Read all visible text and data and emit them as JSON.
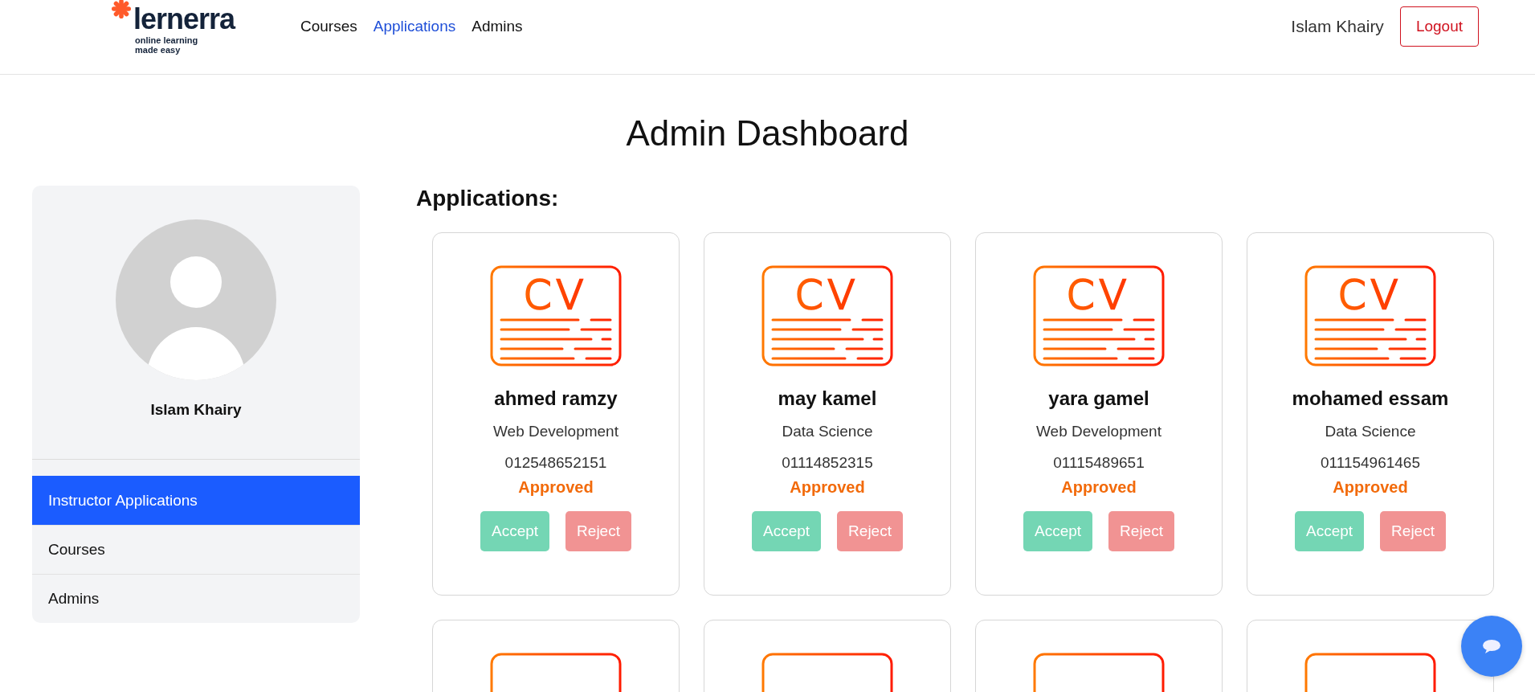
{
  "header": {
    "logo": {
      "name": "lernerra",
      "tagline_1": "online learning",
      "tagline_2": "made easy"
    },
    "nav": [
      {
        "label": "Courses",
        "selected": false
      },
      {
        "label": "Applications",
        "selected": true
      },
      {
        "label": "Admins",
        "selected": false
      }
    ],
    "user_name": "Islam Khairy",
    "logout": "Logout"
  },
  "title": "Admin Dashboard",
  "sidebar": {
    "user_name": "Islam Khairy",
    "items": [
      {
        "label": "Instructor Applications",
        "selected": true
      },
      {
        "label": "Courses",
        "selected": false
      },
      {
        "label": "Admins",
        "selected": false
      }
    ]
  },
  "applications": {
    "heading": "Applications:",
    "cards": [
      {
        "icon_label": "CV",
        "name": "ahmed ramzy",
        "track": "Web Development",
        "phone": "012548652151",
        "status": "Approved",
        "accept": "Accept",
        "reject": "Reject"
      },
      {
        "icon_label": "CV",
        "name": "may kamel",
        "track": "Data Science",
        "phone": "01114852315",
        "status": "Approved",
        "accept": "Accept",
        "reject": "Reject"
      },
      {
        "icon_label": "CV",
        "name": "yara gamel",
        "track": "Web Development",
        "phone": "01115489651",
        "status": "Approved",
        "accept": "Accept",
        "reject": "Reject"
      },
      {
        "icon_label": "CV",
        "name": "mohamed essam",
        "track": "Data Science",
        "phone": "011154961465",
        "status": "Approved",
        "accept": "Accept",
        "reject": "Reject"
      }
    ],
    "cards_partial": [
      {
        "kind": "cv"
      },
      {
        "kind": "cv"
      },
      {
        "kind": "cv"
      },
      {
        "kind": "cv"
      }
    ]
  }
}
